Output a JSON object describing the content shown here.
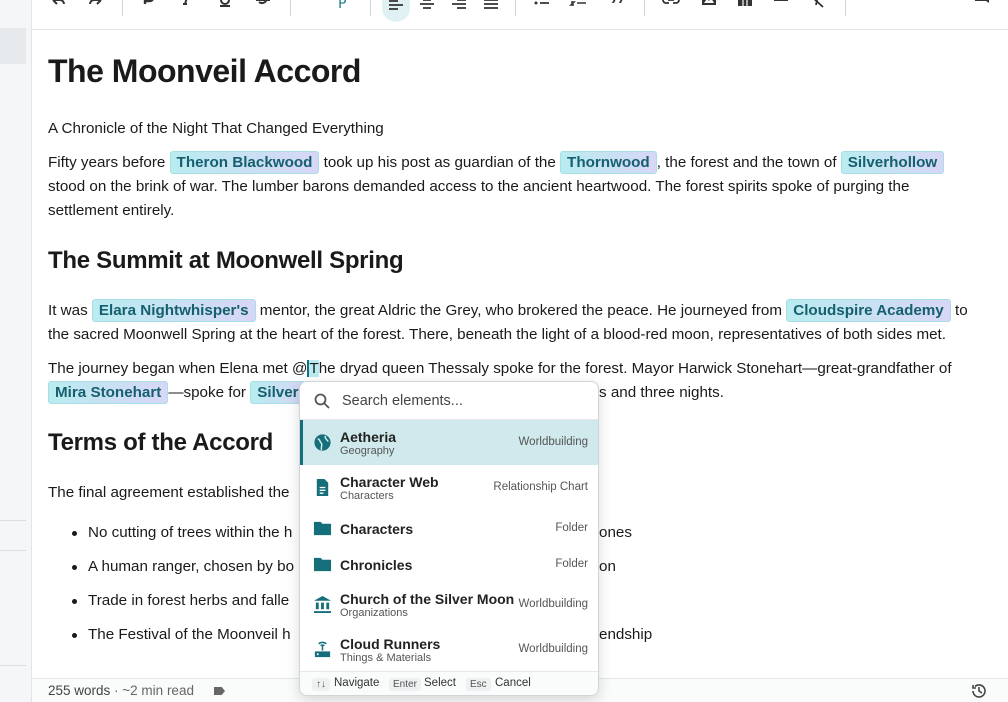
{
  "toolbar": {
    "paragraph_style": "P",
    "items": [
      "undo-icon",
      "redo-icon",
      "bold-icon",
      "italic-icon",
      "underline-icon",
      "strikethrough-icon",
      "align-left-icon",
      "align-center-icon",
      "align-right-icon",
      "align-justify-icon",
      "bullet-list-icon",
      "numbered-list-icon",
      "blockquote-icon",
      "link-icon",
      "image-icon",
      "table-icon",
      "horizontal-rule-icon",
      "clear-format-icon",
      "comment-icon"
    ]
  },
  "document": {
    "title": "The Moonveil Accord",
    "subtitle": "A Chronicle of the Night That Changed Everything",
    "p1": {
      "t1": "Fifty years before ",
      "m1": "Theron Blackwood",
      "t2": " took up his post as guardian of the ",
      "m2": "Thornwood",
      "t3": ", the forest and the town of ",
      "m3": "Silverhollow",
      "line2": "stood on the brink of war. The lumber barons demanded access to the ancient heartwood. The forest spirits spoke of purging the",
      "line3": "settlement entirely."
    },
    "h2_summit": "The Summit at Moonwell Spring",
    "p2": {
      "t1": "It was ",
      "m1": "Elara Nightwhisper's",
      "t2": " mentor, the great Aldric the Grey, who brokered the peace. He journeyed from ",
      "m2": "Cloudspire Academy",
      "t3": " to",
      "line2": "the sacred Moonwell Spring at the heart of the forest. There, beneath the light of a blood-red moon, representatives of both sides met."
    },
    "p3": {
      "t1": "The journey began when Elena met @",
      "cursor_char": "T",
      "t2": "he dryad queen Thessaly spoke for the forest. Mayor Harwick Stonehart—great-grandfather of",
      "m1": "Mira Stonehart",
      "t3": "—spoke for ",
      "m2": "Silver",
      "t4": "s and three nights."
    },
    "h2_terms": "Terms of the Accord",
    "p4": "The final agreement established the",
    "bullets": [
      {
        "left": "No cutting of trees within the h",
        "right": "ones"
      },
      {
        "left": "A human ranger, chosen by bo",
        "right": "on"
      },
      {
        "left": "Trade in forest herbs and falle",
        "right": ""
      },
      {
        "left": "The Festival of the Moonveil h",
        "right": "endship"
      }
    ]
  },
  "status": {
    "words": "255 words",
    "read_time": " · ~2 min read"
  },
  "popup": {
    "search_placeholder": "Search elements...",
    "items": [
      {
        "title": "Aetheria",
        "sub": "Geography",
        "tag": "Worldbuilding",
        "icon": "globe-icon"
      },
      {
        "title": "Character Web",
        "sub": "Characters",
        "tag": "Relationship Chart",
        "icon": "document-icon"
      },
      {
        "title": "Characters",
        "sub": "",
        "tag": "Folder",
        "icon": "folder-icon"
      },
      {
        "title": "Chronicles",
        "sub": "",
        "tag": "Folder",
        "icon": "folder-icon"
      },
      {
        "title": "Church of the Silver Moon",
        "sub": "Organizations",
        "tag": "Worldbuilding",
        "icon": "institution-icon"
      },
      {
        "title": "Cloud Runners",
        "sub": "Things & Materials",
        "tag": "Worldbuilding",
        "icon": "router-icon"
      }
    ],
    "footer": {
      "navigate_key": "↑↓",
      "navigate": "Navigate",
      "select_key": "Enter",
      "select": "Select",
      "cancel_key": "Esc",
      "cancel": "Cancel"
    }
  },
  "colors": {
    "accent": "#146f7b",
    "mention_bg_start": "#b9ecf0",
    "mention_bg_end": "#d8d6f6",
    "selected_row": "#cfe9ec"
  }
}
